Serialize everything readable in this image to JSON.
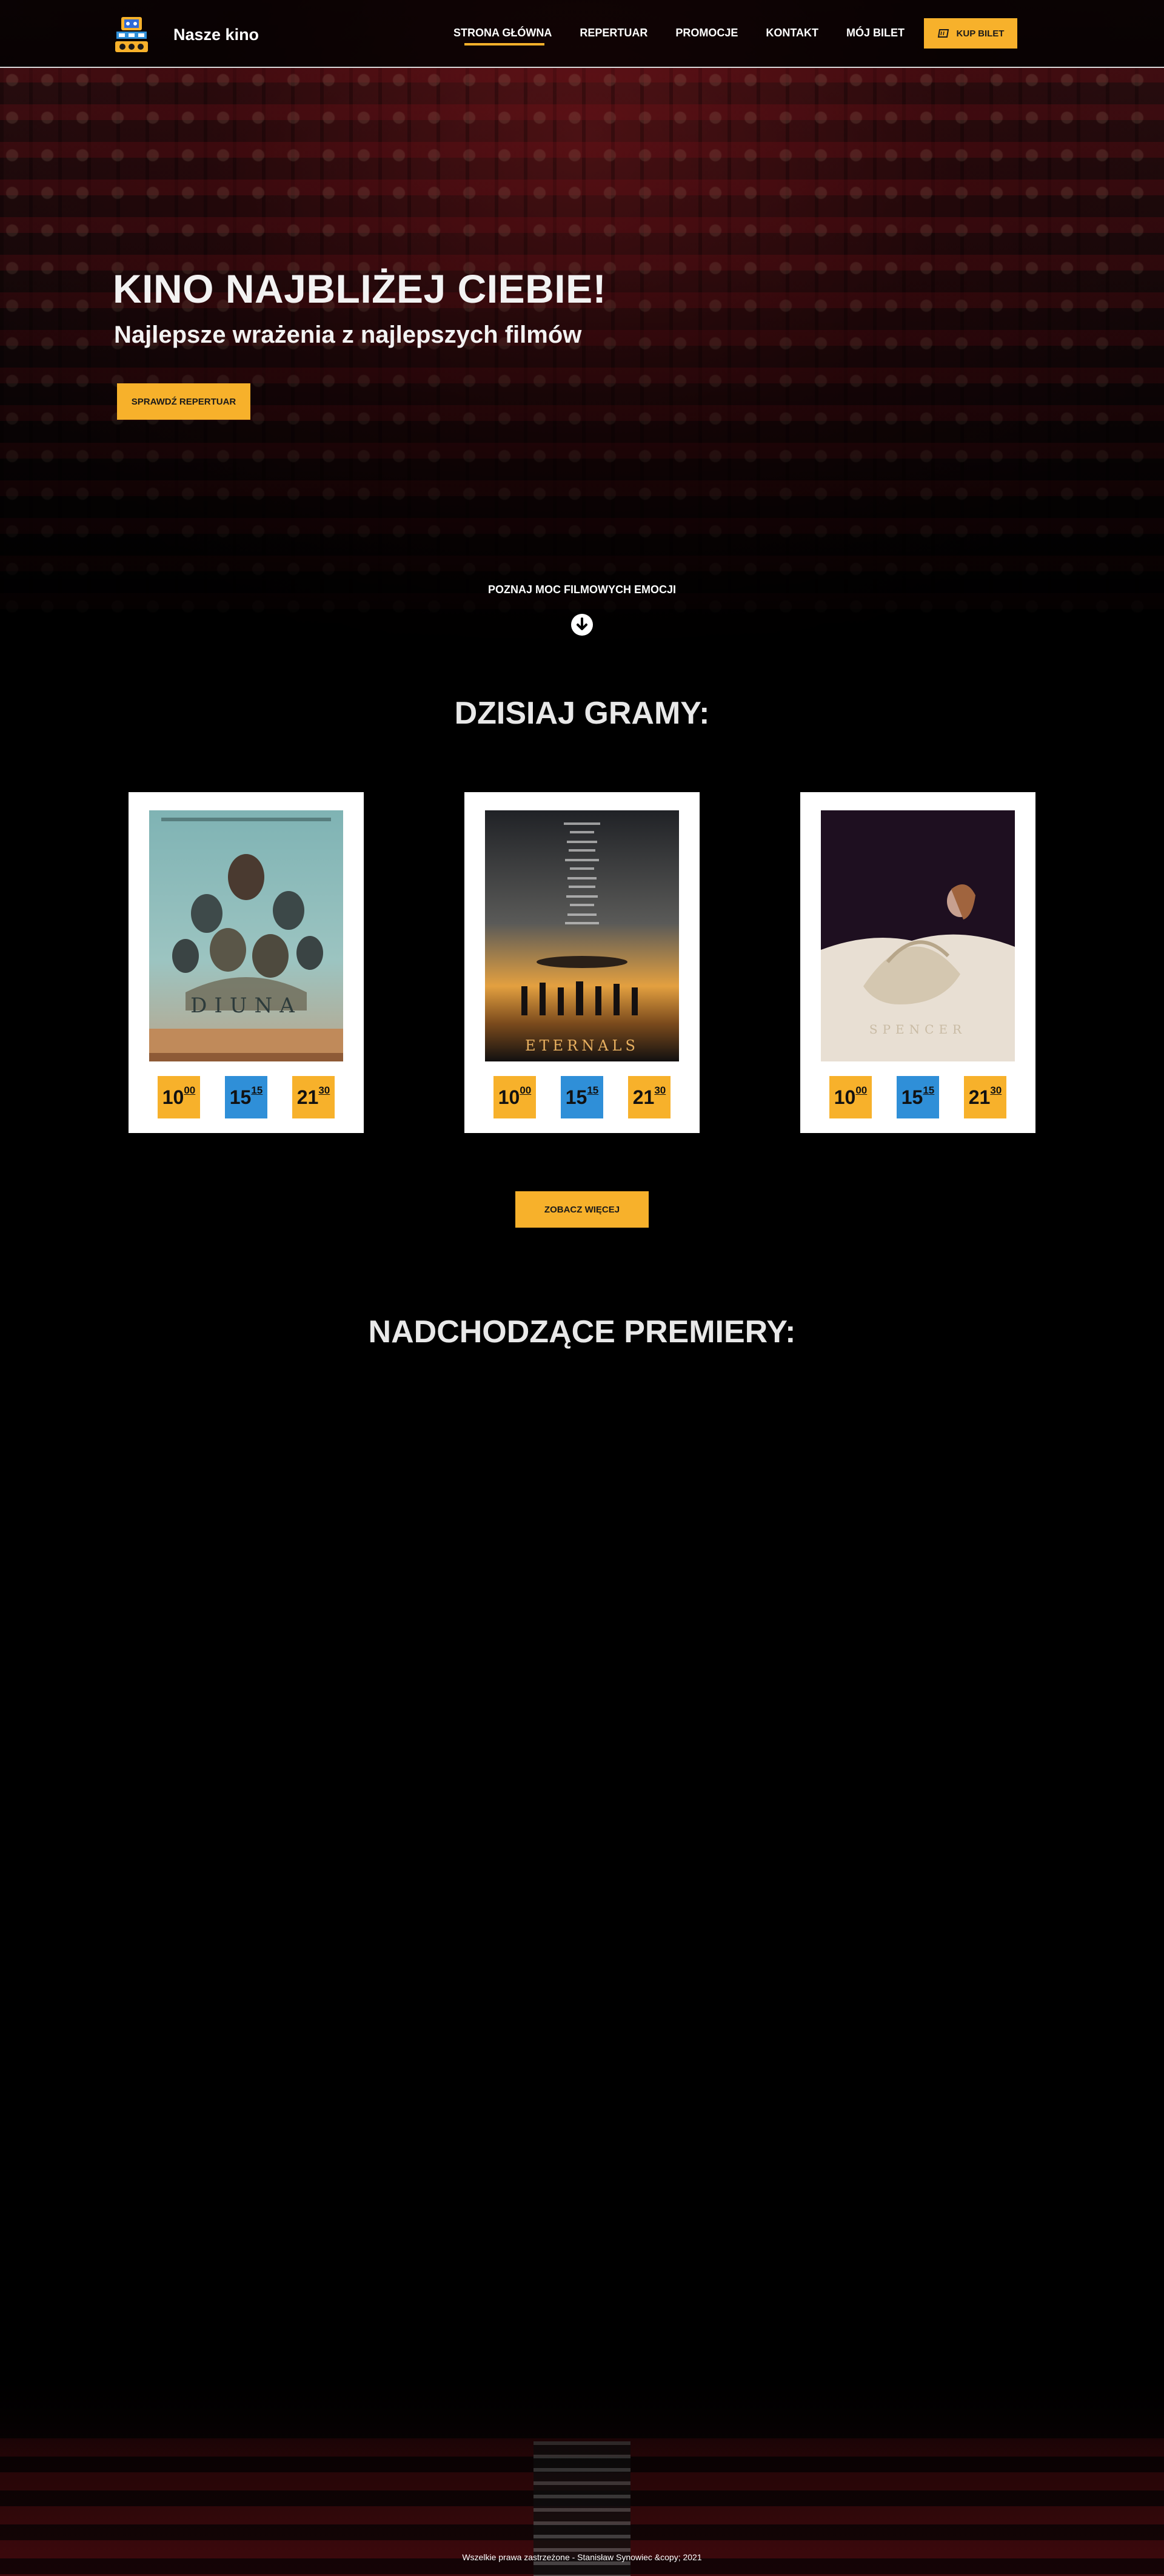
{
  "brand": {
    "name": "Nasze kino"
  },
  "nav": {
    "items": [
      {
        "label": "STRONA GŁÓWNA",
        "active": true
      },
      {
        "label": "REPERTUAR",
        "active": false
      },
      {
        "label": "PROMOCJE",
        "active": false
      },
      {
        "label": "KONTAKT",
        "active": false
      },
      {
        "label": "MÓJ BILET",
        "active": false
      }
    ],
    "buy_ticket": "KUP BILET"
  },
  "hero": {
    "title": "KINO NAJBLIŻEJ CIEBIE!",
    "subtitle": "Najlepsze wrażenia z najlepszych filmów",
    "button": "SPRAWDŹ REPERTUAR",
    "scroll_hint": "POZNAJ MOC FILMOWYCH EMOCJI"
  },
  "today": {
    "title": "DZISIAJ GRAMY:",
    "movies": [
      {
        "poster_title": "DIUNA",
        "showtimes": [
          {
            "hour": "10",
            "min": "00"
          },
          {
            "hour": "15",
            "min": "15"
          },
          {
            "hour": "21",
            "min": "30"
          }
        ]
      },
      {
        "poster_title": "ETERNALS",
        "showtimes": [
          {
            "hour": "10",
            "min": "00"
          },
          {
            "hour": "15",
            "min": "15"
          },
          {
            "hour": "21",
            "min": "30"
          }
        ]
      },
      {
        "poster_title": "SPENCER",
        "showtimes": [
          {
            "hour": "10",
            "min": "00"
          },
          {
            "hour": "15",
            "min": "15"
          },
          {
            "hour": "21",
            "min": "30"
          }
        ]
      }
    ],
    "more_button": "ZOBACZ WIĘCEJ"
  },
  "premieres": {
    "title": "NADCHODZĄCE PREMIERY:"
  },
  "footer": {
    "text": "Wszelkie prawa zastrzeżone - Stanisław Synowiec &copy; 2021"
  },
  "colors": {
    "accent": "#f7b12b",
    "blue": "#2f8fd8",
    "background": "#000000"
  }
}
